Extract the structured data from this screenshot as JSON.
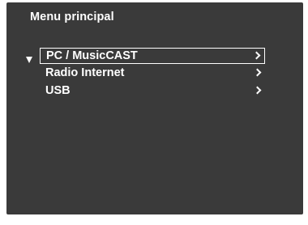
{
  "screen": {
    "title": "Menu principal"
  },
  "menu": {
    "items": [
      {
        "label": "PC / MusicCAST",
        "selected": true,
        "icon": "chevron-right-icon"
      },
      {
        "label": "Radio Internet",
        "selected": false,
        "icon": "chevron-right-icon"
      },
      {
        "label": "USB",
        "selected": false,
        "icon": "chevron-right-icon"
      }
    ],
    "cursor_icon": "triangle-down-icon"
  },
  "colors": {
    "background": "#3a3a3a",
    "text": "#ffffff"
  }
}
